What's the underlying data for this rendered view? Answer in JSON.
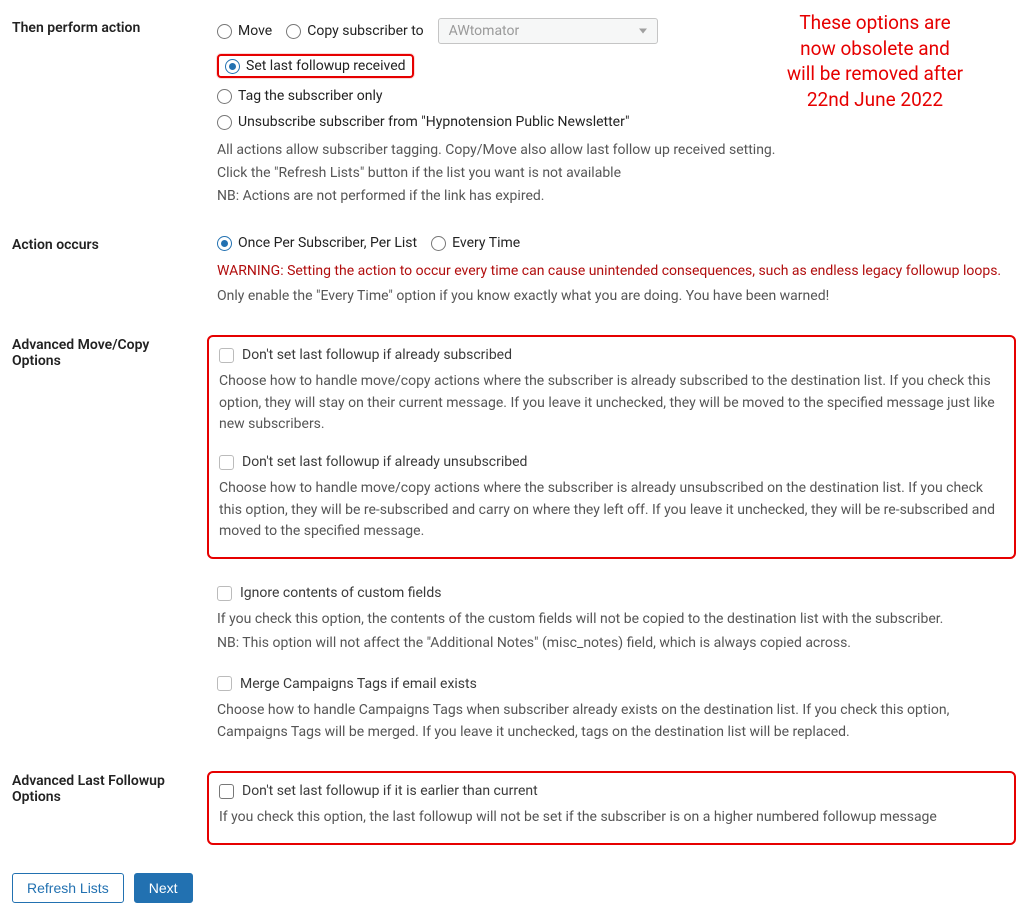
{
  "action": {
    "section_label": "Then perform action",
    "opts": {
      "move": "Move",
      "copy": "Copy subscriber to",
      "set_followup": "Set last followup received",
      "tag_only": "Tag the subscriber only",
      "unsubscribe": "Unsubscribe subscriber from  \"Hypnotension Public Newsletter\""
    },
    "dest_list": "AWtomator",
    "help1": "All actions allow subscriber tagging. Copy/Move also allow last follow up received setting.",
    "help2": "Click the \"Refresh Lists\" button if the list you want is not available",
    "help3": "NB: Actions are not performed if the link has expired."
  },
  "annotation": {
    "l1": "These options are",
    "l2": "now obsolete and",
    "l3": "will be removed after",
    "l4": "22nd June 2022"
  },
  "occurs": {
    "label": "Action occurs",
    "once": "Once Per Subscriber, Per List",
    "every": "Every Time",
    "warning": "WARNING: Setting the action to occur every time can cause unintended consequences, such as endless legacy followup loops.",
    "note": "Only enable the \"Every Time\" option if you know exactly what you are doing. You have been warned!"
  },
  "adv_move": {
    "label_l1": "Advanced Move/Copy",
    "label_l2": "Options",
    "c1_label": "Don't set last followup if already subscribed",
    "c1_help": "Choose how to handle move/copy actions where the subscriber is already subscribed to the destination list. If you check this option, they will stay on their current message. If you leave it unchecked, they will be moved to the specified message just like new subscribers.",
    "c2_label": "Don't set last followup if already unsubscribed",
    "c2_help": "Choose how to handle move/copy actions where the subscriber is already unsubscribed on the destination list. If you check this option, they will be re-subscribed and carry on where they left off. If you leave it unchecked, they will be re-subscribed and moved to the specified message.",
    "c3_label": "Ignore contents of custom fields",
    "c3_help1": "If you check this option, the contents of the custom fields will not be copied to the destination list with the subscriber.",
    "c3_help2": "NB: This option will not affect the \"Additional Notes\" (misc_notes) field, which is always copied across.",
    "c4_label": "Merge Campaigns Tags if email exists",
    "c4_help": "Choose how to handle Campaigns Tags when subscriber already exists on the destination list. If you check this option, Campaigns Tags will be merged. If you leave it unchecked, tags on the destination list will be replaced."
  },
  "adv_follow": {
    "label_l1": "Advanced Last Followup",
    "label_l2": "Options",
    "c_label": "Don't set last followup if it is earlier than current",
    "c_help": "If you check this option, the last followup will not be set if the subscriber is on a higher numbered followup message"
  },
  "buttons": {
    "refresh": "Refresh Lists",
    "next": "Next"
  }
}
